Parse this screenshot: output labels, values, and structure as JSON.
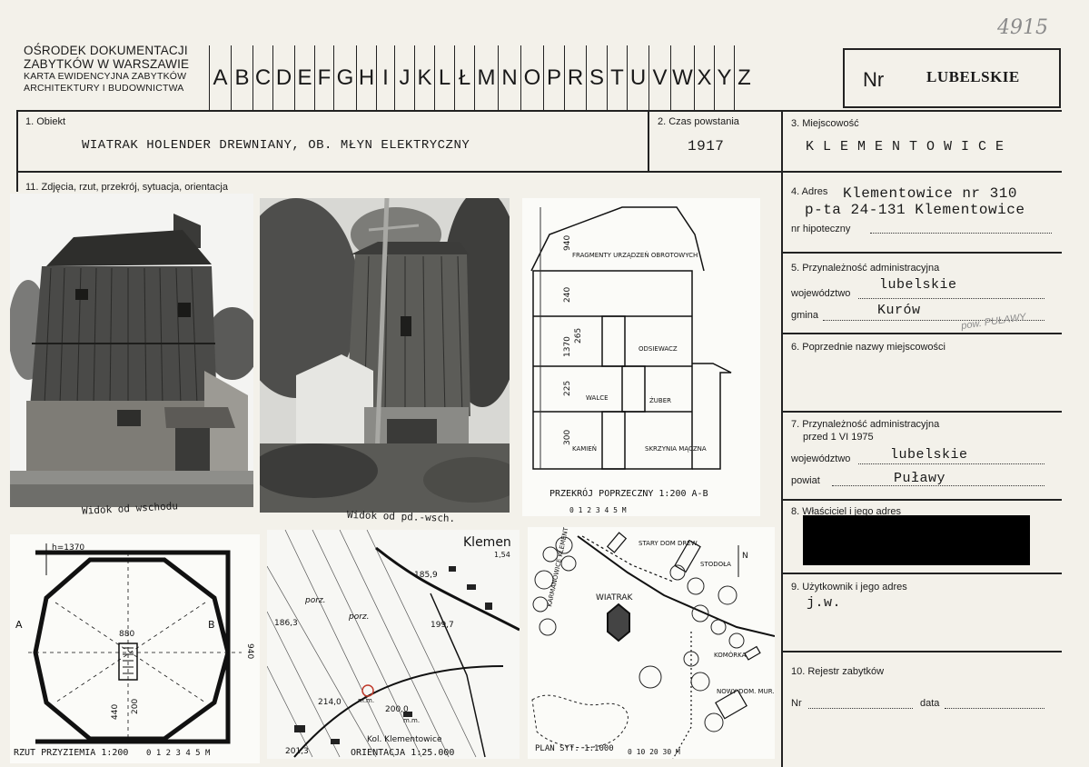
{
  "header": {
    "org_line1": "OŚRODEK DOKUMENTACJI",
    "org_line2": "ZABYTKÓW W WARSZAWIE",
    "org_line3": "KARTA EWIDENCYJNA ZABYTKÓW",
    "org_line4": "ARCHITEKTURY I BUDOWNICTWA",
    "letters": [
      "A",
      "B",
      "C",
      "D",
      "E",
      "F",
      "G",
      "H",
      "I",
      "J",
      "K",
      "L",
      "Ł",
      "M",
      "N",
      "O",
      "P",
      "R",
      "S",
      "T",
      "U",
      "V",
      "W",
      "X",
      "Y",
      "Z"
    ],
    "nr_label": "Nr",
    "voivodeship": "LUBELSKIE",
    "handwritten_number": "4915"
  },
  "fields": {
    "obiekt_label": "1. Obiekt",
    "obiekt_value": "WIATRAK HOLENDER DREWNIANY, OB. MŁYN ELEKTRYCZNY",
    "czas_label": "2. Czas powstania",
    "czas_value": "1917",
    "miejsc_label": "3. Miejscowość",
    "miejsc_value": "K L E M E N T O W I C E",
    "zdjecia_label": "11. Zdjęcia, rzut, przekrój, sytuacja, orientacja",
    "adres_label": "4. Adres",
    "adres_value1": "Klementowice nr 310",
    "adres_value2": "p-ta 24-131 Klementowice",
    "hipoteczny_label": "nr hipoteczny",
    "przyn_label": "5. Przynależność administracyjna",
    "woj_label": "województwo",
    "woj_value": "lubelskie",
    "gmina_label": "gmina",
    "gmina_value": "Kurów",
    "pow_note": "pow. PUŁAWY",
    "poprz_label": "6. Poprzednie nazwy miejscowości",
    "przyn75_label": "7. Przynależność administracyjna",
    "przed_label": "przed 1 VI 1975",
    "woj75_label": "województwo",
    "woj75_value": "lubelskie",
    "powiat_label": "powiat",
    "powiat_value": "Puławy",
    "wlasciciel_label": "8. Właściciel i jego adres",
    "uzytkownik_label": "9. Użytkownik i jego adres",
    "uzytkownik_value": "j.w.",
    "rejestr_label": "10. Rejestr zabytków",
    "nr_label": "Nr",
    "data_label": "data"
  },
  "captions": {
    "photo1": "Widok od wschodu",
    "photo2": "Widok od pd.-wsch.",
    "section_title": "PRZEKRÓJ POPRZECZNY  1:200  A-B",
    "section_scale": "0  1  2  3  4  5 M",
    "section_fragment": "FRAGMENTY URZĄDZEŃ OBROTOWYCH",
    "section_room1": "ODSIEWACZ",
    "section_room2": "WALCE",
    "section_room3": "ŻUBER",
    "section_room4": "KAMIEŃ",
    "section_room5": "SKRZYNIA MĄCZNA",
    "dim_940": "940",
    "dim_240": "240",
    "dim_1370": "1370",
    "dim_265": "265",
    "dim_225": "225",
    "dim_300": "300",
    "plan_h": "h=1370",
    "plan_a": "A",
    "plan_b": "B",
    "plan_880": "880",
    "plan_940": "940",
    "plan_440": "440",
    "plan_200": "200",
    "plan_title": "RZUT PRZYZIEMIA 1:200",
    "plan_scale": "0  1  2  3  4  5 M",
    "map_top": "Klemen",
    "map_154": "1,54",
    "map_1859": "185,9",
    "map_1863": "186,3",
    "map_1997": "199,7",
    "map_porz1": "porz.",
    "map_porz2": "porz.",
    "map_2140": "214,0",
    "map_2000": "200,0",
    "map_mm1": "m.m.",
    "map_mm2": "m.m.",
    "map_2013": "201,3",
    "map_kol": "Kol. Klementowice",
    "map_orient": "ORIENTACJA 1:25.000",
    "site_stary": "STARY DOM DREW.",
    "site_stodola": "STODOŁA",
    "site_wiatrak": "WIATRAK",
    "site_komorka": "KOMÓRKA",
    "site_nowy": "NOWY DOM. MUR.",
    "site_road": "KARMANOWICE  KLEMENTOWICE",
    "site_n": "N",
    "site_title": "PLAN SYT. 1:1000",
    "site_scale": "0     10     20    30 M"
  }
}
